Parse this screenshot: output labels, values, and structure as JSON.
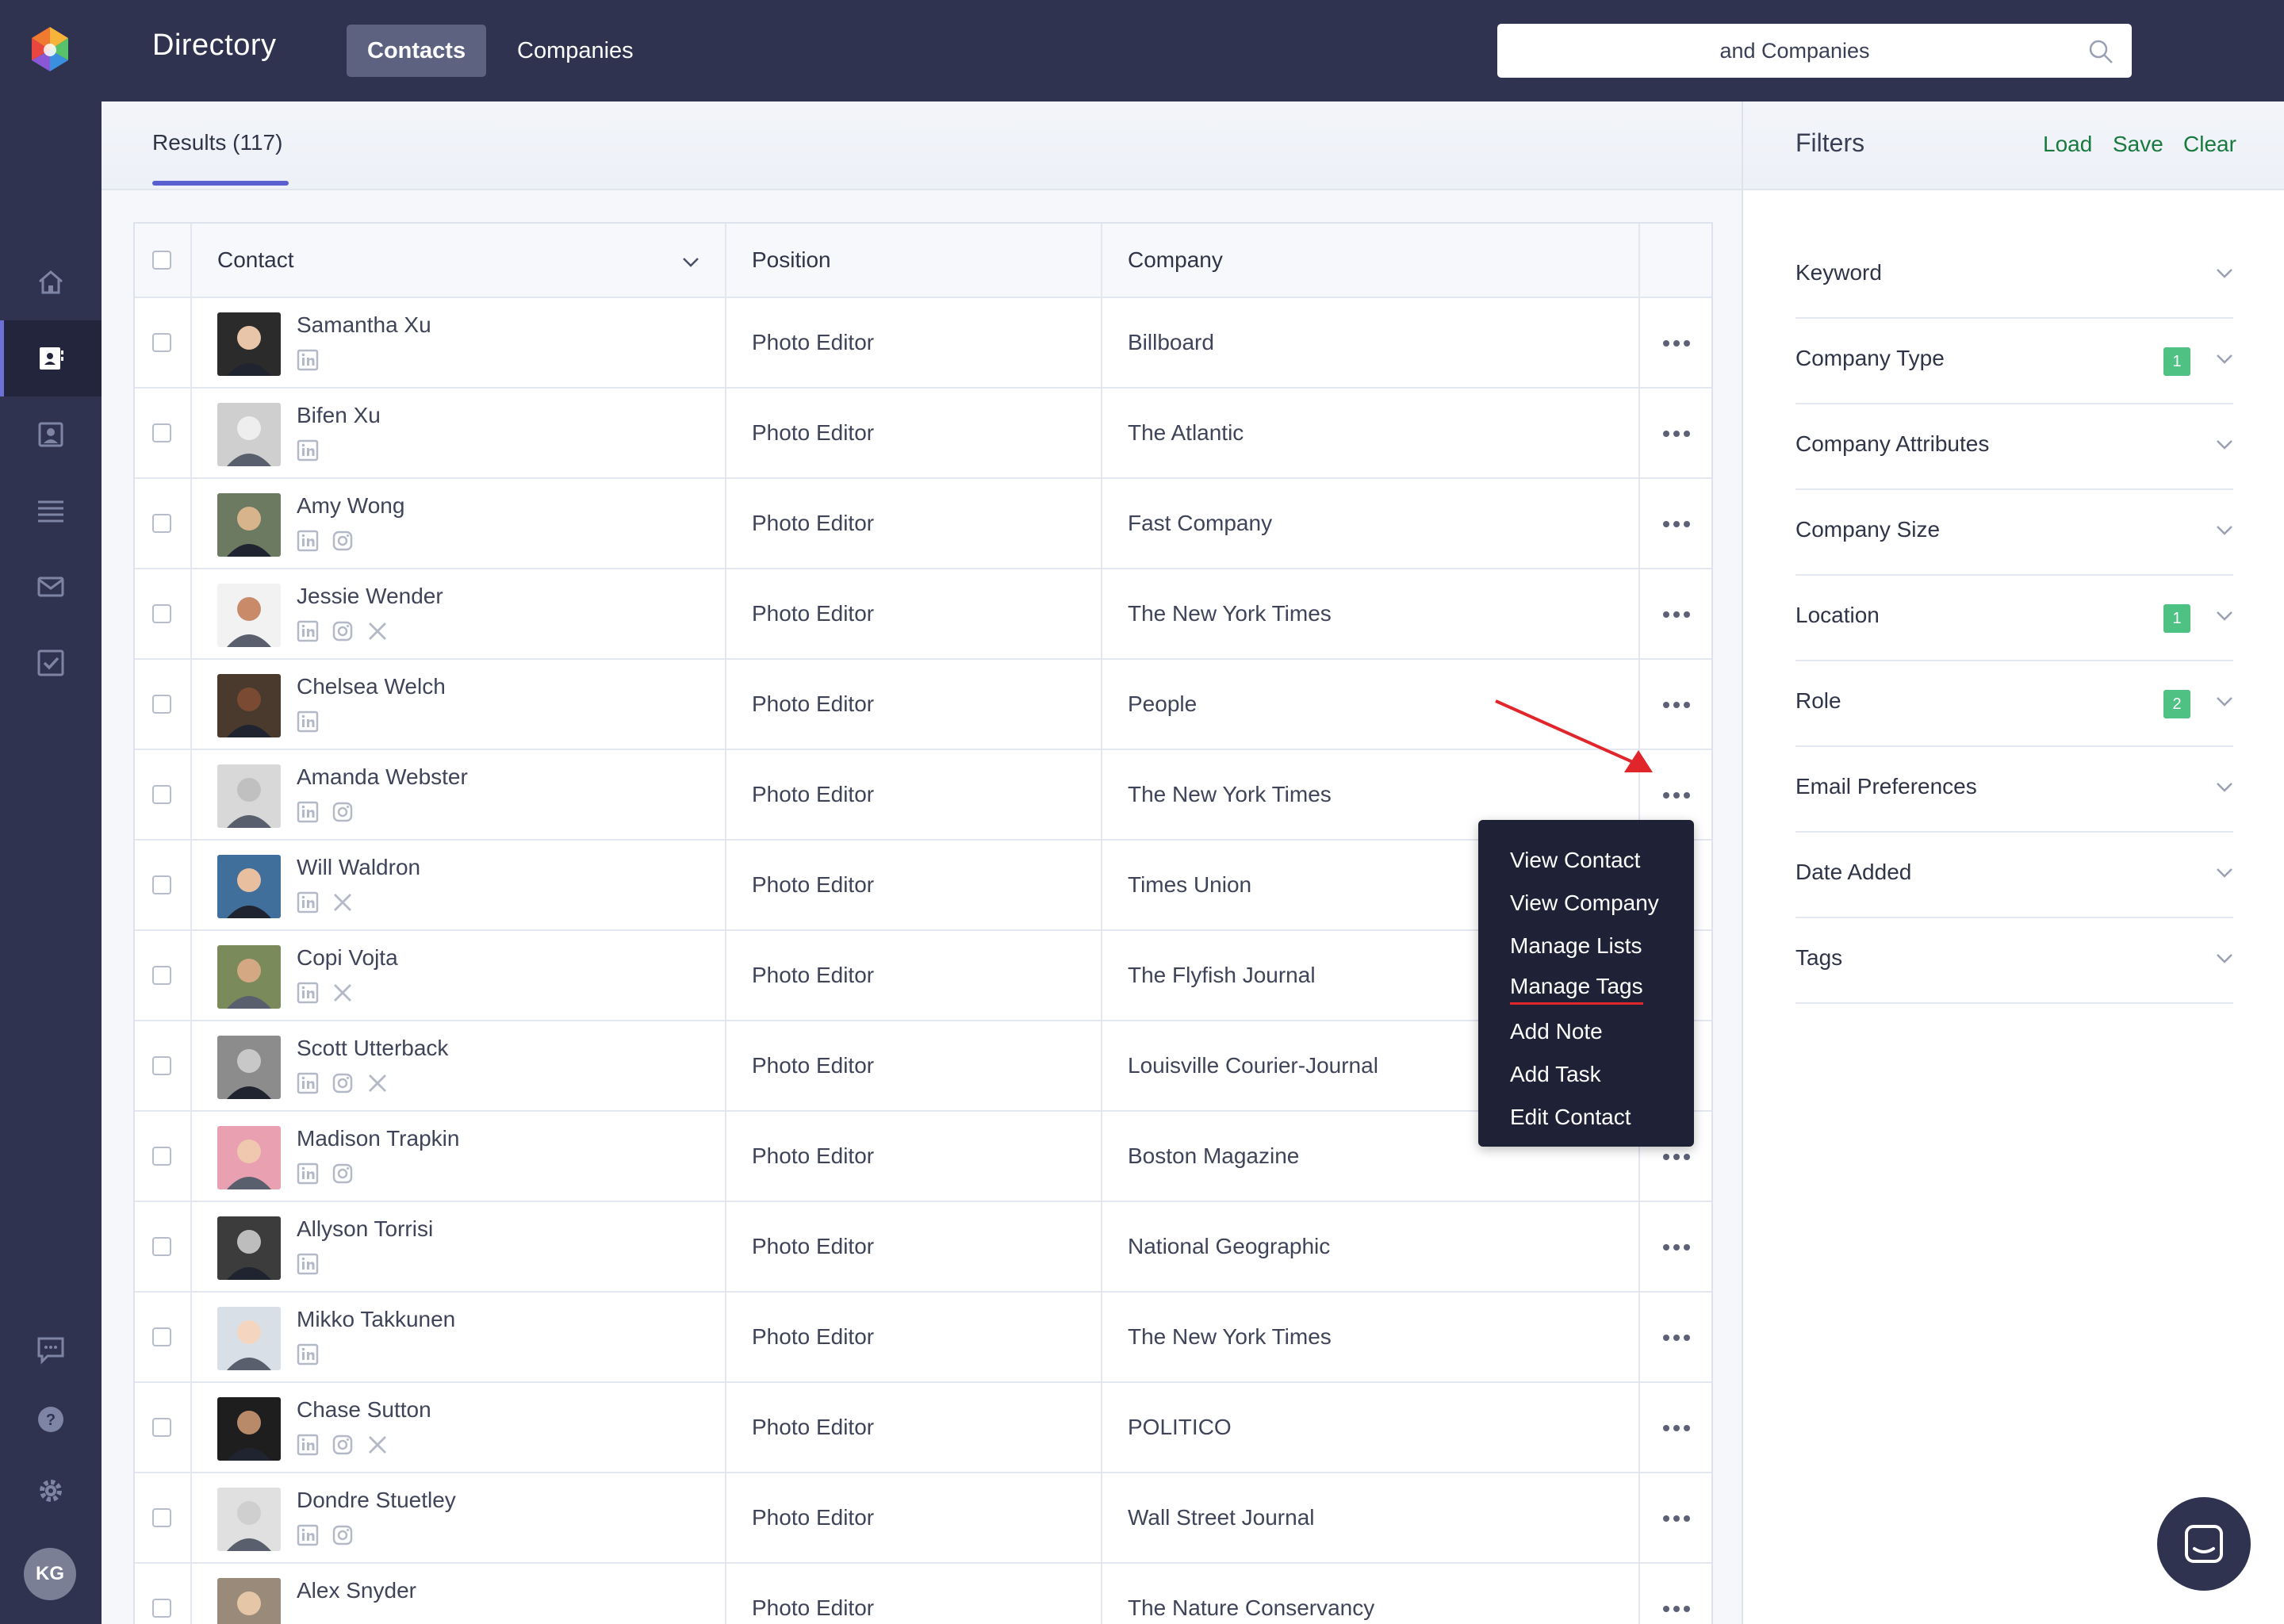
{
  "app": {
    "title": "Directory",
    "tabs": [
      {
        "label": "Contacts",
        "active": true
      },
      {
        "label": "Companies",
        "active": false
      }
    ],
    "search": {
      "value": "and Companies"
    },
    "user_initials": "KG"
  },
  "sidebar": {
    "icons": [
      "home-icon",
      "contacts-icon",
      "profile-icon",
      "list-icon",
      "mail-icon",
      "tasks-icon"
    ],
    "bottom_icons": [
      "feedback-icon",
      "help-icon",
      "settings-icon"
    ]
  },
  "results": {
    "tab_label": "Results (117)"
  },
  "table": {
    "headers": {
      "contact": "Contact",
      "position": "Position",
      "company": "Company"
    },
    "rows": [
      {
        "name": "Samantha Xu",
        "position": "Photo Editor",
        "company": "Billboard",
        "socials": [
          "linkedin"
        ]
      },
      {
        "name": "Bifen Xu",
        "position": "Photo Editor",
        "company": "The Atlantic",
        "socials": [
          "linkedin"
        ]
      },
      {
        "name": "Amy Wong",
        "position": "Photo Editor",
        "company": "Fast Company",
        "socials": [
          "linkedin",
          "instagram"
        ]
      },
      {
        "name": "Jessie Wender",
        "position": "Photo Editor",
        "company": "The New York Times",
        "socials": [
          "linkedin",
          "instagram",
          "x"
        ]
      },
      {
        "name": "Chelsea Welch",
        "position": "Photo Editor",
        "company": "People",
        "socials": [
          "linkedin"
        ]
      },
      {
        "name": "Amanda Webster",
        "position": "Photo Editor",
        "company": "The New York Times",
        "socials": [
          "linkedin",
          "instagram"
        ]
      },
      {
        "name": "Will Waldron",
        "position": "Photo Editor",
        "company": "Times Union",
        "socials": [
          "linkedin",
          "x"
        ]
      },
      {
        "name": "Copi Vojta",
        "position": "Photo Editor",
        "company": "The Flyfish Journal",
        "socials": [
          "linkedin",
          "x"
        ]
      },
      {
        "name": "Scott Utterback",
        "position": "Photo Editor",
        "company": "Louisville Courier-Journal",
        "socials": [
          "linkedin",
          "instagram",
          "x"
        ]
      },
      {
        "name": "Madison Trapkin",
        "position": "Photo Editor",
        "company": "Boston Magazine",
        "socials": [
          "linkedin",
          "instagram"
        ]
      },
      {
        "name": "Allyson Torrisi",
        "position": "Photo Editor",
        "company": "National Geographic",
        "socials": [
          "linkedin"
        ]
      },
      {
        "name": "Mikko Takkunen",
        "position": "Photo Editor",
        "company": "The New York Times",
        "socials": [
          "linkedin"
        ]
      },
      {
        "name": "Chase Sutton",
        "position": "Photo Editor",
        "company": "POLITICO",
        "socials": [
          "linkedin",
          "instagram",
          "x"
        ]
      },
      {
        "name": "Dondre Stuetley",
        "position": "Photo Editor",
        "company": "Wall Street Journal",
        "socials": [
          "linkedin",
          "instagram"
        ]
      },
      {
        "name": "Alex Snyder",
        "position": "Photo Editor",
        "company": "The Nature Conservancy",
        "socials": []
      }
    ]
  },
  "context_menu": {
    "items": [
      "View Contact",
      "View Company",
      "Manage Lists",
      "Manage Tags",
      "Add Note",
      "Add Task",
      "Edit Contact"
    ],
    "highlighted": "Manage Tags"
  },
  "filters": {
    "title": "Filters",
    "actions": [
      "Load",
      "Save",
      "Clear"
    ],
    "items": [
      {
        "label": "Keyword",
        "count": null
      },
      {
        "label": "Company Type",
        "count": "1"
      },
      {
        "label": "Company Attributes",
        "count": null
      },
      {
        "label": "Company Size",
        "count": null
      },
      {
        "label": "Location",
        "count": "1"
      },
      {
        "label": "Role",
        "count": "2"
      },
      {
        "label": "Email Preferences",
        "count": null
      },
      {
        "label": "Date Added",
        "count": null
      },
      {
        "label": "Tags",
        "count": null
      }
    ]
  },
  "colors": {
    "nav_bg": "#2f3350",
    "accent": "#5a5fd0",
    "filter_link": "#177a3e",
    "badge": "#4fc283",
    "annotation": "#e0262b"
  }
}
